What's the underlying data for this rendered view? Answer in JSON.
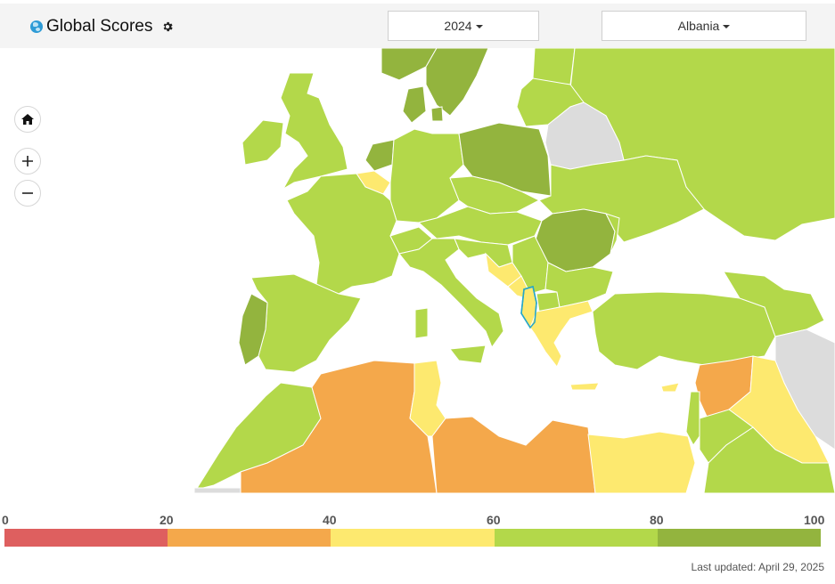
{
  "header": {
    "title": "Global Scores",
    "year_selected": "2024",
    "country_selected": "Albania"
  },
  "icons": {
    "globe": "globe-icon",
    "settings": "gear-icon",
    "home": "home-icon",
    "zoom_in": "plus-icon",
    "zoom_out": "minus-icon",
    "caret": "caret-down-icon"
  },
  "map": {
    "region": "Europe & Mediterranean",
    "highlighted_country": "Albania",
    "score_classes": {
      "no_data": "#dcdcdc",
      "0-20": "#de5f5f",
      "20-40": "#f4a84b",
      "40-60": "#fde96f",
      "60-80": "#b3d84a",
      "80-100": "#93b43e"
    },
    "highlight_outline": "#25a6c9",
    "water": "#ffffff"
  },
  "legend": {
    "ticks": [
      "0",
      "20",
      "40",
      "60",
      "80",
      "100"
    ],
    "bands": [
      {
        "range": "0-20",
        "color": "#de5f5f"
      },
      {
        "range": "20-40",
        "color": "#f4a84b"
      },
      {
        "range": "40-60",
        "color": "#fde96f"
      },
      {
        "range": "60-80",
        "color": "#b3d84a"
      },
      {
        "range": "80-100",
        "color": "#93b43e"
      }
    ]
  },
  "footer": {
    "last_updated": "Last updated: April 29, 2025"
  }
}
